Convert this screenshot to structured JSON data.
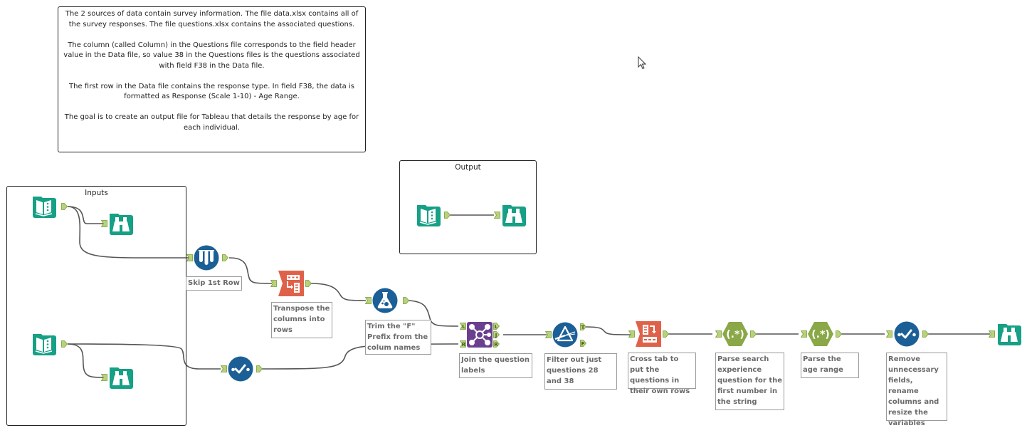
{
  "comment": {
    "paragraphs": [
      "The 2 sources of data contain survey information. The file data.xlsx contains all of the survey responses. The file questions.xlsx contains the associated questions.",
      "The column (called Column) in the Questions file corresponds to the field header value in the Data file, so value 38 in the Questions files is the questions associated with field F38 in the Data file.",
      "The first row in the Data file contains the response type. In field F38, the data is formatted as Response (Scale 1-10) - Age Range.",
      "The goal is to create an output file for Tableau that details the response by age for each individual."
    ]
  },
  "containers": {
    "inputs": {
      "title": "Inputs"
    },
    "output": {
      "title": "Output"
    }
  },
  "colors": {
    "io_teal": "#16a085",
    "prep_blue": "#1c5f96",
    "transform_orange": "#e0614a",
    "join_purple": "#6b3f8f",
    "parse_green": "#8aa848",
    "anchor_green": "#b8d27a",
    "wire": "#555555"
  },
  "tools": {
    "input_data": {
      "type": "Input Data"
    },
    "browse_data": {
      "type": "Browse"
    },
    "input_questions": {
      "type": "Input Data"
    },
    "browse_questions": {
      "type": "Browse"
    },
    "input_output": {
      "type": "Input Data"
    },
    "browse_output": {
      "type": "Browse"
    },
    "sample": {
      "type": "Sample",
      "annotation": "Skip 1st Row"
    },
    "transpose": {
      "type": "Transpose",
      "annotation": "Transpose the columns into rows"
    },
    "formula": {
      "type": "Formula",
      "annotation": "Trim the \"F\" Prefix from the colum names"
    },
    "select_questions": {
      "type": "Select"
    },
    "join": {
      "type": "Join",
      "annotation": "Join the question labels",
      "anchors": {
        "left_in": "L",
        "right_in": "R",
        "left_out": "L",
        "join_out": "J",
        "right_out": "R"
      }
    },
    "filter": {
      "type": "Filter",
      "annotation": "Filter out just questions 28 and 38",
      "anchors": {
        "true_out": "T",
        "false_out": "F"
      }
    },
    "crosstab": {
      "type": "Cross Tab",
      "annotation": "Cross tab to put the questions in their own rows"
    },
    "regex1": {
      "type": "RegEx",
      "glyph": "(.*)",
      "annotation": "Parse search experience question for the first number in the string"
    },
    "regex2": {
      "type": "RegEx",
      "glyph": "(.*)",
      "annotation": "Parse the age range"
    },
    "select_final": {
      "type": "Select",
      "annotation": "Remove unnecessary fields, rename columns and resize the variables"
    },
    "browse_final": {
      "type": "Browse"
    }
  }
}
